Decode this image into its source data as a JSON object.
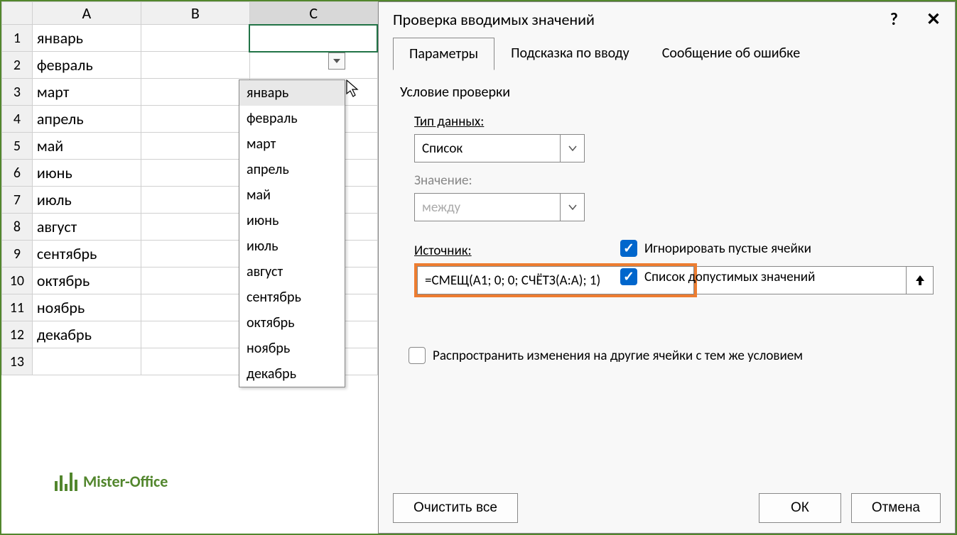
{
  "sheet": {
    "columns": [
      "A",
      "B",
      "C"
    ],
    "rows": [
      {
        "n": "1",
        "a": "январь"
      },
      {
        "n": "2",
        "a": "февраль"
      },
      {
        "n": "3",
        "a": "март"
      },
      {
        "n": "4",
        "a": "апрель"
      },
      {
        "n": "5",
        "a": "май"
      },
      {
        "n": "6",
        "a": "июнь"
      },
      {
        "n": "7",
        "a": "июль"
      },
      {
        "n": "8",
        "a": "август"
      },
      {
        "n": "9",
        "a": "сентябрь"
      },
      {
        "n": "10",
        "a": "октябрь"
      },
      {
        "n": "11",
        "a": "ноябрь"
      },
      {
        "n": "12",
        "a": "декабрь"
      },
      {
        "n": "13",
        "a": ""
      }
    ]
  },
  "dropdown": {
    "items": [
      "январь",
      "февраль",
      "март",
      "апрель",
      "май",
      "июнь",
      "июль",
      "август",
      "сентябрь",
      "октябрь",
      "ноябрь",
      "декабрь"
    ]
  },
  "logo": {
    "text": "Mister-Office"
  },
  "dialog": {
    "title": "Проверка вводимых значений",
    "help": "?",
    "close": "✕",
    "tabs": {
      "params": "Параметры",
      "hint": "Подсказка по вводу",
      "error": "Сообщение об ошибке"
    },
    "group": "Условие проверки",
    "type_label": "Тип данных:",
    "type_value": "Список",
    "value_label": "Значение:",
    "value_value": "между",
    "ignore_empty": "Игнорировать пустые ячейки",
    "list_in_cell": "Список допустимых значений",
    "source_label": "Источник:",
    "source_value": "=СМЕЩ(A1; 0; 0; СЧЁТЗ(A:A); 1)",
    "propagate": "Распространить изменения на другие ячейки с тем же условием",
    "clear": "Очистить все",
    "ok": "ОК",
    "cancel": "Отмена"
  }
}
